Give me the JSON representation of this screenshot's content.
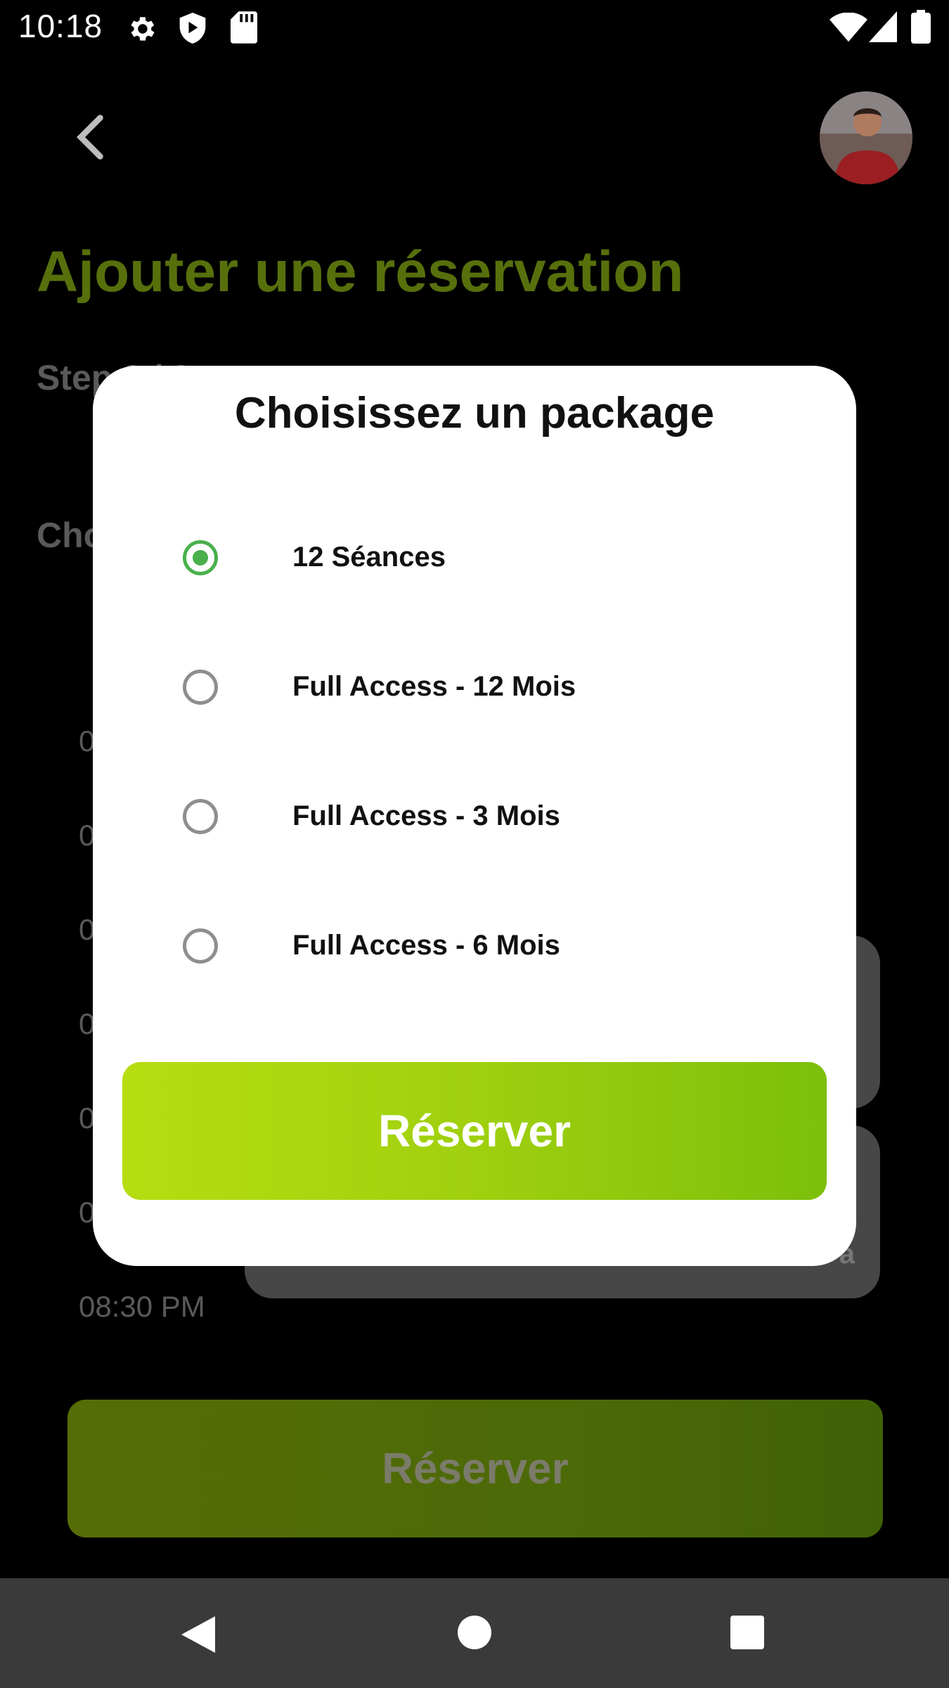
{
  "status_bar": {
    "time": "10:18",
    "icons": [
      "settings-icon",
      "shield-play-icon",
      "sd-card-icon",
      "wifi-icon",
      "signal-icon",
      "battery-icon"
    ]
  },
  "header": {
    "back_icon": "chevron-left-icon",
    "avatar_icon": "user-avatar"
  },
  "page": {
    "title": "Ajouter une réservation",
    "step_label": "Step 3 / 3",
    "choose_label": "Choisissez"
  },
  "background_list": {
    "time_slots": [
      "0",
      "0",
      "0",
      "0",
      "0",
      "0",
      "08:30 PM"
    ],
    "card_text": "a"
  },
  "background_button": {
    "label": "Réserver"
  },
  "dialog": {
    "title": "Choisissez un package",
    "options": [
      {
        "label": "12 Séances",
        "selected": true
      },
      {
        "label": "Full Access - 12 Mois",
        "selected": false
      },
      {
        "label": "Full Access - 3 Mois",
        "selected": false
      },
      {
        "label": "Full Access - 6 Mois",
        "selected": false
      }
    ],
    "reserve_label": "Réserver"
  },
  "colors": {
    "title_green": "#57700c",
    "radio_selected": "#49b04c",
    "button_gradient_start": "#b7dd12",
    "button_gradient_end": "#7cbf0b"
  },
  "nav_bar": {
    "icons": [
      "back-triangle-icon",
      "home-circle-icon",
      "recents-square-icon"
    ]
  }
}
